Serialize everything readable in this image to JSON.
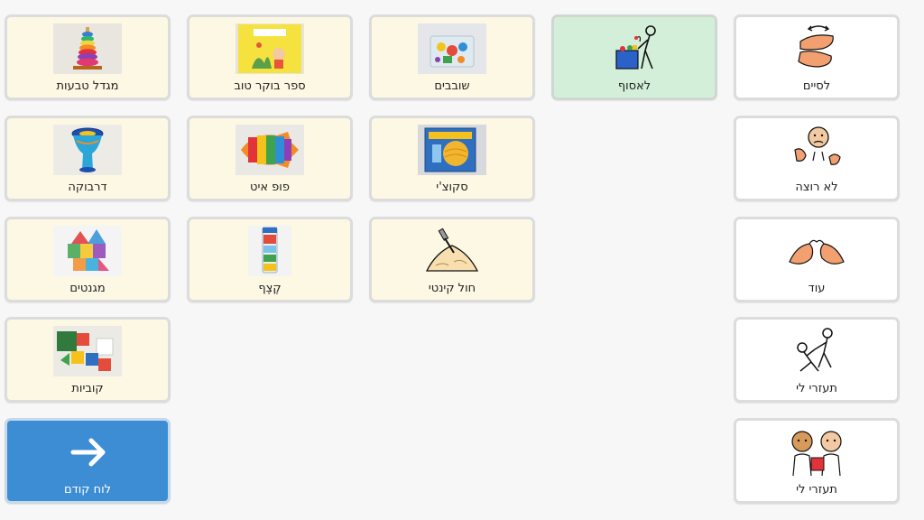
{
  "tiles": {
    "r1c1": {
      "label": "מגדל טבעות",
      "icon": "ring-tower-photo"
    },
    "r1c2": {
      "label": "ספר בוקר טוב",
      "icon": "book-cover-photo"
    },
    "r1c3": {
      "label": "שובבים",
      "icon": "toys-box-photo"
    },
    "r1c4": {
      "label": "לאסוף",
      "icon": "collect-symbol"
    },
    "r1c5": {
      "label": "לסיים",
      "icon": "finish-symbol"
    },
    "r2c1": {
      "label": "דרבוקה",
      "icon": "darbuka-photo"
    },
    "r2c2": {
      "label": "פופ איט",
      "icon": "pop-it-photo"
    },
    "r2c3": {
      "label": "סקוצ'י",
      "icon": "squishy-photo"
    },
    "r2c5": {
      "label": "לא רוצה",
      "icon": "dont-want-symbol"
    },
    "r3c1": {
      "label": "מגנטים",
      "icon": "magnet-tiles-photo"
    },
    "r3c2": {
      "label": "קֶצֶף",
      "icon": "foam-photo"
    },
    "r3c3": {
      "label": "חול קינטי",
      "icon": "kinetic-sand-symbol"
    },
    "r3c5": {
      "label": "עוד",
      "icon": "more-symbol"
    },
    "r4c1": {
      "label": "קוביות",
      "icon": "blocks-photo"
    },
    "r4c5": {
      "label": "תעזרי לי",
      "icon": "help-symbol"
    },
    "r5c5": {
      "label": "תעזרי לי",
      "icon": "help-give-symbol"
    }
  },
  "nav": {
    "label": "לוח קודם",
    "icon": "arrow-right-icon"
  },
  "colors": {
    "toy_bg": "#fdf8e4",
    "core_bg": "#ffffff",
    "selected_bg": "#d4efd9",
    "nav_bg": "#3d8dd4"
  }
}
